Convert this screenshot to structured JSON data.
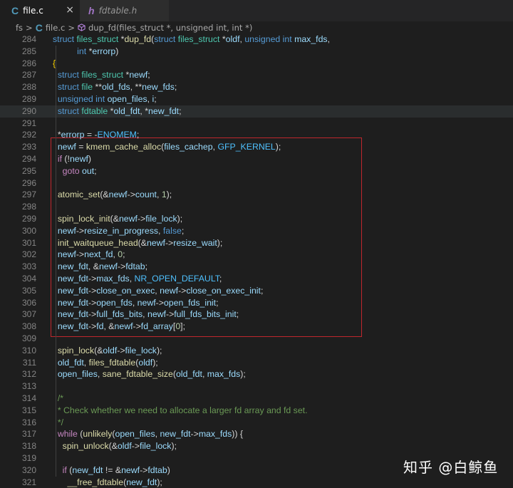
{
  "tabs": [
    {
      "icon": "C",
      "label": "file.c",
      "active": true,
      "close": "×"
    },
    {
      "icon": "h",
      "label": "fdtable.h",
      "active": false
    }
  ],
  "breadcrumb": {
    "folder": "fs",
    "sep": ">",
    "file_icon": "C",
    "file": "file.c",
    "symbol": "dup_fd(files_struct *, unsigned int, int *)"
  },
  "watermark": "知乎 @白鲸鱼",
  "lines": [
    {
      "n": "284",
      "tokens": [
        [
          "k",
          "struct "
        ],
        [
          "ty",
          "files_struct "
        ],
        [
          "",
          "*"
        ],
        [
          "fn",
          "dup_fd"
        ],
        [
          "",
          "("
        ],
        [
          "k",
          "struct "
        ],
        [
          "ty",
          "files_struct "
        ],
        [
          "",
          "*"
        ],
        [
          "v",
          "oldf"
        ],
        [
          "",
          ", "
        ],
        [
          "k",
          "unsigned int "
        ],
        [
          "v",
          "max_fds"
        ],
        [
          "",
          ","
        ]
      ]
    },
    {
      "n": "285",
      "tokens": [
        [
          "",
          "          "
        ],
        [
          "k",
          "int "
        ],
        [
          "",
          "*"
        ],
        [
          "v",
          "errorp"
        ],
        [
          "",
          ")"
        ]
      ]
    },
    {
      "n": "286",
      "tokens": [
        [
          "bracket",
          "{"
        ]
      ]
    },
    {
      "n": "287",
      "tokens": [
        [
          "",
          "  "
        ],
        [
          "k",
          "struct "
        ],
        [
          "ty",
          "files_struct "
        ],
        [
          "",
          "*"
        ],
        [
          "v",
          "newf"
        ],
        [
          "",
          ";"
        ]
      ]
    },
    {
      "n": "288",
      "tokens": [
        [
          "",
          "  "
        ],
        [
          "k",
          "struct "
        ],
        [
          "ty",
          "file "
        ],
        [
          "",
          "**"
        ],
        [
          "v",
          "old_fds"
        ],
        [
          "",
          ", **"
        ],
        [
          "v",
          "new_fds"
        ],
        [
          "",
          ";"
        ]
      ]
    },
    {
      "n": "289",
      "tokens": [
        [
          "",
          "  "
        ],
        [
          "k",
          "unsigned int "
        ],
        [
          "v",
          "open_files"
        ],
        [
          "",
          ", "
        ],
        [
          "v",
          "i"
        ],
        [
          "",
          ";"
        ]
      ]
    },
    {
      "n": "290",
      "tokens": [
        [
          "",
          "  "
        ],
        [
          "k",
          "struct "
        ],
        [
          "ty",
          "fdtable "
        ],
        [
          "",
          "*"
        ],
        [
          "v",
          "old_fdt"
        ],
        [
          "",
          ", *"
        ],
        [
          "v",
          "new_fdt"
        ],
        [
          "",
          ";"
        ]
      ]
    },
    {
      "n": "291",
      "tokens": []
    },
    {
      "n": "292",
      "tokens": [
        [
          "",
          "  *"
        ],
        [
          "v",
          "errorp"
        ],
        [
          "",
          " = -"
        ],
        [
          "con",
          "ENOMEM"
        ],
        [
          "",
          ";"
        ]
      ]
    },
    {
      "n": "293",
      "tokens": [
        [
          "",
          "  "
        ],
        [
          "v",
          "newf"
        ],
        [
          "",
          " = "
        ],
        [
          "fn",
          "kmem_cache_alloc"
        ],
        [
          "",
          "("
        ],
        [
          "v",
          "files_cachep"
        ],
        [
          "",
          ", "
        ],
        [
          "con",
          "GFP_KERNEL"
        ],
        [
          "",
          ");"
        ]
      ]
    },
    {
      "n": "294",
      "tokens": [
        [
          "",
          "  "
        ],
        [
          "ctl",
          "if "
        ],
        [
          "",
          "(!"
        ],
        [
          "v",
          "newf"
        ],
        [
          "",
          ")"
        ]
      ]
    },
    {
      "n": "295",
      "tokens": [
        [
          "",
          "    "
        ],
        [
          "ctl",
          "goto "
        ],
        [
          "v",
          "out"
        ],
        [
          "",
          ";"
        ]
      ]
    },
    {
      "n": "296",
      "tokens": []
    },
    {
      "n": "297",
      "tokens": [
        [
          "",
          "  "
        ],
        [
          "fn",
          "atomic_set"
        ],
        [
          "",
          "(&"
        ],
        [
          "v",
          "newf"
        ],
        [
          "",
          "->"
        ],
        [
          "v",
          "count"
        ],
        [
          "",
          ", "
        ],
        [
          "n",
          "1"
        ],
        [
          "",
          ");"
        ]
      ]
    },
    {
      "n": "298",
      "tokens": []
    },
    {
      "n": "299",
      "tokens": [
        [
          "",
          "  "
        ],
        [
          "fn",
          "spin_lock_init"
        ],
        [
          "",
          "(&"
        ],
        [
          "v",
          "newf"
        ],
        [
          "",
          "->"
        ],
        [
          "v",
          "file_lock"
        ],
        [
          "",
          ");"
        ]
      ]
    },
    {
      "n": "300",
      "tokens": [
        [
          "",
          "  "
        ],
        [
          "v",
          "newf"
        ],
        [
          "",
          "->"
        ],
        [
          "v",
          "resize_in_progress"
        ],
        [
          "",
          ", "
        ],
        [
          "k",
          "false"
        ],
        [
          "",
          ";"
        ]
      ]
    },
    {
      "n": "301",
      "tokens": [
        [
          "",
          "  "
        ],
        [
          "fn",
          "init_waitqueue_head"
        ],
        [
          "",
          "(&"
        ],
        [
          "v",
          "newf"
        ],
        [
          "",
          "->"
        ],
        [
          "v",
          "resize_wait"
        ],
        [
          "",
          ");"
        ]
      ]
    },
    {
      "n": "302",
      "tokens": [
        [
          "",
          "  "
        ],
        [
          "v",
          "newf"
        ],
        [
          "",
          "->"
        ],
        [
          "v",
          "next_fd"
        ],
        [
          "",
          ", "
        ],
        [
          "n",
          "0"
        ],
        [
          "",
          ";"
        ]
      ]
    },
    {
      "n": "303",
      "tokens": [
        [
          "",
          "  "
        ],
        [
          "v",
          "new_fdt"
        ],
        [
          "",
          ", &"
        ],
        [
          "v",
          "newf"
        ],
        [
          "",
          "->"
        ],
        [
          "v",
          "fdtab"
        ],
        [
          "",
          ";"
        ]
      ]
    },
    {
      "n": "304",
      "tokens": [
        [
          "",
          "  "
        ],
        [
          "v",
          "new_fdt"
        ],
        [
          "",
          "->"
        ],
        [
          "v",
          "max_fds"
        ],
        [
          "",
          ", "
        ],
        [
          "con",
          "NR_OPEN_DEFAULT"
        ],
        [
          "",
          ";"
        ]
      ]
    },
    {
      "n": "305",
      "tokens": [
        [
          "",
          "  "
        ],
        [
          "v",
          "new_fdt"
        ],
        [
          "",
          "->"
        ],
        [
          "v",
          "close_on_exec"
        ],
        [
          "",
          ", "
        ],
        [
          "v",
          "newf"
        ],
        [
          "",
          "->"
        ],
        [
          "v",
          "close_on_exec_init"
        ],
        [
          "",
          ";"
        ]
      ]
    },
    {
      "n": "306",
      "tokens": [
        [
          "",
          "  "
        ],
        [
          "v",
          "new_fdt"
        ],
        [
          "",
          "->"
        ],
        [
          "v",
          "open_fds"
        ],
        [
          "",
          ", "
        ],
        [
          "v",
          "newf"
        ],
        [
          "",
          "->"
        ],
        [
          "v",
          "open_fds_init"
        ],
        [
          "",
          ";"
        ]
      ]
    },
    {
      "n": "307",
      "tokens": [
        [
          "",
          "  "
        ],
        [
          "v",
          "new_fdt"
        ],
        [
          "",
          "->"
        ],
        [
          "v",
          "full_fds_bits"
        ],
        [
          "",
          ", "
        ],
        [
          "v",
          "newf"
        ],
        [
          "",
          "->"
        ],
        [
          "v",
          "full_fds_bits_init"
        ],
        [
          "",
          ";"
        ]
      ]
    },
    {
      "n": "308",
      "tokens": [
        [
          "",
          "  "
        ],
        [
          "v",
          "new_fdt"
        ],
        [
          "",
          "->"
        ],
        [
          "v",
          "fd"
        ],
        [
          "",
          ", &"
        ],
        [
          "v",
          "newf"
        ],
        [
          "",
          "->"
        ],
        [
          "v",
          "fd_array"
        ],
        [
          "",
          "["
        ],
        [
          "n",
          "0"
        ],
        [
          "",
          "];"
        ]
      ]
    },
    {
      "n": "309",
      "tokens": []
    },
    {
      "n": "310",
      "tokens": [
        [
          "",
          "  "
        ],
        [
          "fn",
          "spin_lock"
        ],
        [
          "",
          "(&"
        ],
        [
          "v",
          "oldf"
        ],
        [
          "",
          "->"
        ],
        [
          "v",
          "file_lock"
        ],
        [
          "",
          ");"
        ]
      ]
    },
    {
      "n": "311",
      "tokens": [
        [
          "",
          "  "
        ],
        [
          "v",
          "old_fdt"
        ],
        [
          "",
          ", "
        ],
        [
          "fn",
          "files_fdtable"
        ],
        [
          "",
          "("
        ],
        [
          "v",
          "oldf"
        ],
        [
          "",
          ");"
        ]
      ]
    },
    {
      "n": "312",
      "tokens": [
        [
          "",
          "  "
        ],
        [
          "v",
          "open_files"
        ],
        [
          "",
          ", "
        ],
        [
          "fn",
          "sane_fdtable_size"
        ],
        [
          "",
          "("
        ],
        [
          "v",
          "old_fdt"
        ],
        [
          "",
          ", "
        ],
        [
          "v",
          "max_fds"
        ],
        [
          "",
          ");"
        ]
      ]
    },
    {
      "n": "313",
      "tokens": []
    },
    {
      "n": "314",
      "tokens": [
        [
          "",
          "  "
        ],
        [
          "cm",
          "/*"
        ]
      ]
    },
    {
      "n": "315",
      "tokens": [
        [
          "",
          "  "
        ],
        [
          "cm",
          "* Check whether we need to allocate a larger fd array and fd set."
        ]
      ]
    },
    {
      "n": "316",
      "tokens": [
        [
          "",
          "  "
        ],
        [
          "cm",
          "*/"
        ]
      ]
    },
    {
      "n": "317",
      "tokens": [
        [
          "",
          "  "
        ],
        [
          "ctl",
          "while "
        ],
        [
          "",
          "("
        ],
        [
          "fn",
          "unlikely"
        ],
        [
          "",
          "("
        ],
        [
          "v",
          "open_files"
        ],
        [
          "",
          ", "
        ],
        [
          "v",
          "new_fdt"
        ],
        [
          "",
          "->"
        ],
        [
          "v",
          "max_fds"
        ],
        [
          "",
          ")) {"
        ]
      ]
    },
    {
      "n": "318",
      "tokens": [
        [
          "",
          "    "
        ],
        [
          "fn",
          "spin_unlock"
        ],
        [
          "",
          "(&"
        ],
        [
          "v",
          "oldf"
        ],
        [
          "",
          "->"
        ],
        [
          "v",
          "file_lock"
        ],
        [
          "",
          ");"
        ]
      ]
    },
    {
      "n": "319",
      "tokens": []
    },
    {
      "n": "320",
      "tokens": [
        [
          "",
          "    "
        ],
        [
          "ctl",
          "if "
        ],
        [
          "",
          "("
        ],
        [
          "v",
          "new_fdt"
        ],
        [
          "",
          " != &"
        ],
        [
          "v",
          "newf"
        ],
        [
          "",
          "->"
        ],
        [
          "v",
          "fdtab"
        ],
        [
          "",
          ")"
        ]
      ]
    },
    {
      "n": "321",
      "tokens": [
        [
          "",
          "      "
        ],
        [
          "fn",
          "__free_fdtable"
        ],
        [
          "",
          "("
        ],
        [
          "v",
          "new_fdt"
        ],
        [
          "",
          ");"
        ]
      ]
    }
  ]
}
